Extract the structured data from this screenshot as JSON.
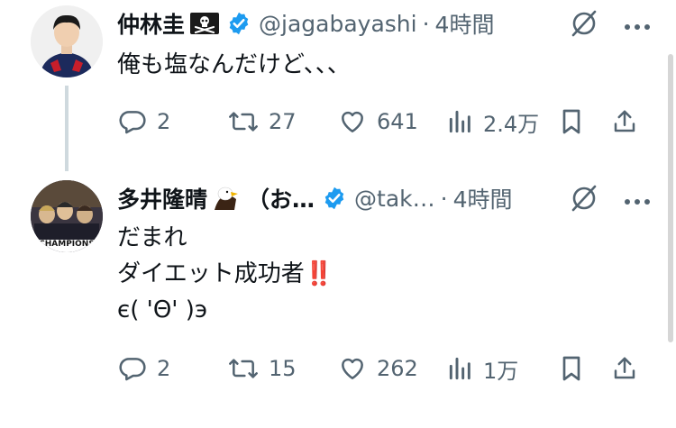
{
  "tweets": [
    {
      "name": "仲林圭",
      "name_emoji": "skull-crossbones-flag-icon",
      "handle": "@jagabayashi",
      "separator": "·",
      "time": "4時間",
      "lines": [
        "俺も塩なんだけど、、、"
      ],
      "stats": {
        "replies": "2",
        "retweets": "27",
        "likes": "641",
        "views": "2.4万"
      }
    },
    {
      "name": "多井隆晴",
      "name_emoji": "eagle-icon",
      "name_suffix": "（お…",
      "handle": "@tak…",
      "separator": "·",
      "time": "4時間",
      "lines": [
        "だまれ",
        "ダイエット成功者‼️",
        "є( 'Θ' )э"
      ],
      "avatar_text": "CHAMPIONS",
      "stats": {
        "replies": "2",
        "retweets": "15",
        "likes": "262",
        "views": "1万"
      }
    }
  ],
  "colors": {
    "text": "#0f1419",
    "muted": "#536471",
    "verified": "#1d9bf0",
    "thread_line": "#cfd9de"
  }
}
